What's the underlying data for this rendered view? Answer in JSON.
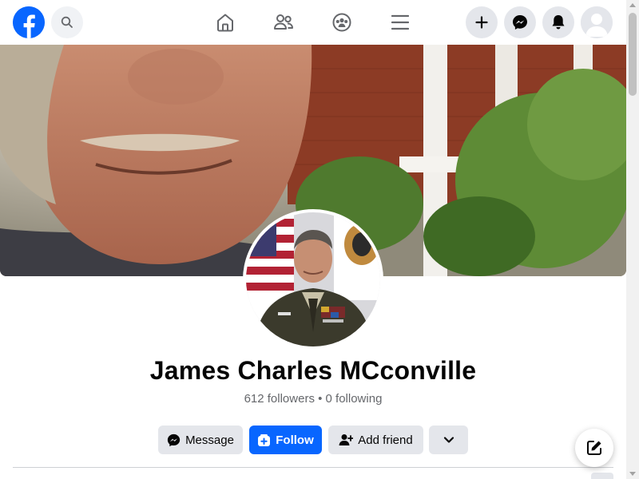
{
  "profile": {
    "name": "James Charles MCconville",
    "stats": "612 followers • 0 following"
  },
  "actions": {
    "message_label": "Message",
    "follow_label": "Follow",
    "add_friend_label": "Add friend"
  },
  "nav": {
    "icons": [
      "home-icon",
      "friends-icon",
      "groups-icon",
      "menu-icon"
    ],
    "right_icons": [
      "create-icon",
      "messenger-icon",
      "notifications-icon",
      "account-avatar"
    ]
  },
  "colors": {
    "brand": "#0866ff",
    "button_gray": "#e4e6eb",
    "text_primary": "#050505",
    "text_secondary": "#65676b"
  }
}
